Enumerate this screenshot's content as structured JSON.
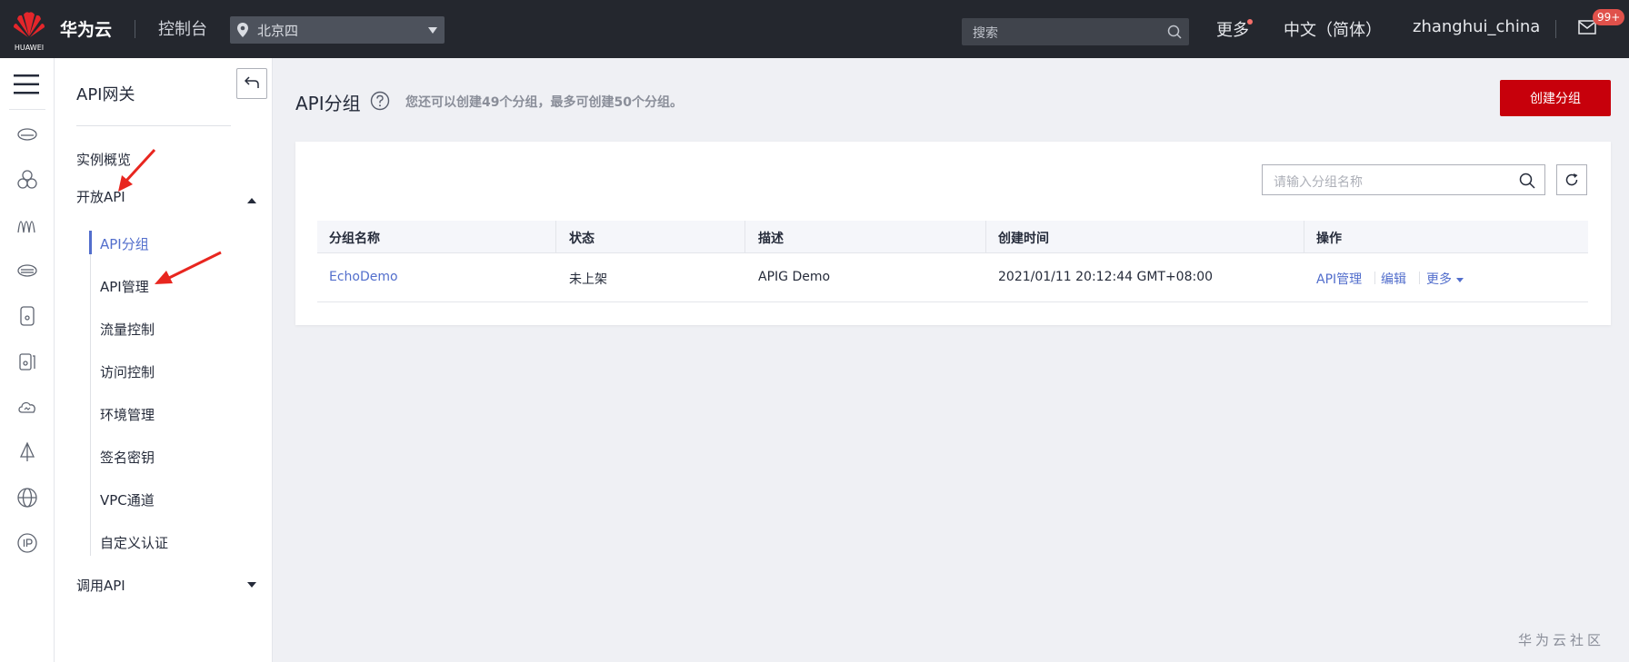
{
  "topbar": {
    "logo_text": "HUAWEI",
    "brand": "华为云",
    "console": "控制台",
    "region": "北京四",
    "search_placeholder": "搜索",
    "more": "更多",
    "language": "中文（简体）",
    "username": "zhanghui_china",
    "badge": "99+"
  },
  "subnav": {
    "title": "API网关",
    "items": [
      {
        "label": "实例概览"
      },
      {
        "label": "开放API"
      },
      {
        "label": "调用API"
      }
    ],
    "sub_items": [
      {
        "label": "API分组"
      },
      {
        "label": "API管理"
      },
      {
        "label": "流量控制"
      },
      {
        "label": "访问控制"
      },
      {
        "label": "环境管理"
      },
      {
        "label": "签名密钥"
      },
      {
        "label": "VPC通道"
      },
      {
        "label": "自定义认证"
      }
    ]
  },
  "main": {
    "title": "API分组",
    "hint": "您还可以创建49个分组，最多可创建50个分组。",
    "create_button": "创建分组",
    "group_search_placeholder": "请输入分组名称",
    "table": {
      "columns": [
        "分组名称",
        "状态",
        "描述",
        "创建时间",
        "操作"
      ],
      "rows": [
        {
          "name": "EchoDemo",
          "status": "未上架",
          "description": "APIG Demo",
          "created": "2021/01/11 20:12:44 GMT+08:00",
          "actions": [
            "API管理",
            "编辑",
            "更多"
          ]
        }
      ]
    }
  },
  "watermark": "华为云社区",
  "colors": {
    "topbar": "#24272e",
    "accent": "#526ecc",
    "primary_button": "#c7000b"
  }
}
